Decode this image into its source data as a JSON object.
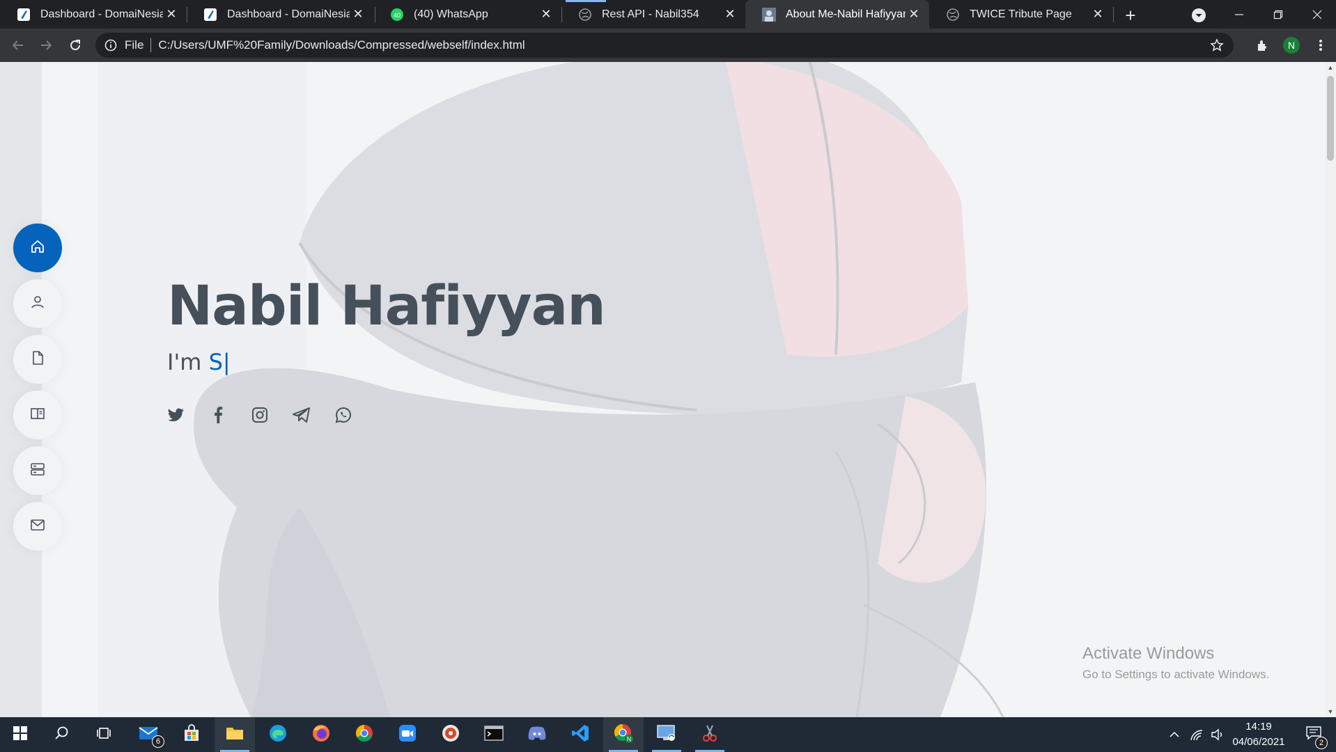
{
  "browser": {
    "tabs": [
      {
        "title": "Dashboard - DomaiNesia",
        "icon": "domainesia-icon",
        "active": false
      },
      {
        "title": "Dashboard - DomaiNesia",
        "icon": "domainesia-icon",
        "active": false
      },
      {
        "title": "(40) WhatsApp",
        "icon": "whatsapp-icon",
        "active": false
      },
      {
        "title": "Rest API - Nabil354",
        "icon": "globe-icon",
        "active": false
      },
      {
        "title": "About Me-Nabil Hafiyyan",
        "icon": "portrait-icon",
        "active": true
      },
      {
        "title": "TWICE Tribute Page",
        "icon": "globe-icon",
        "active": false
      }
    ],
    "close_glyph": "✕",
    "new_tab_glyph": "+",
    "address": {
      "scheme": "File",
      "url": "C:/Users/UMF%20Family/Downloads/Compressed/webself/index.html"
    },
    "profile_initial": "N"
  },
  "page": {
    "name": "Nabil Hafiyyan",
    "subtitle_prefix": "I'm ",
    "subtitle_typed": "S",
    "cursor": "|",
    "accent": "#0563bb",
    "text_color": "#45505b",
    "nav": [
      {
        "icon": "home-icon",
        "active": true
      },
      {
        "icon": "user-icon",
        "active": false
      },
      {
        "icon": "file-icon",
        "active": false
      },
      {
        "icon": "book-icon",
        "active": false
      },
      {
        "icon": "server-icon",
        "active": false
      },
      {
        "icon": "envelope-icon",
        "active": false
      }
    ],
    "socials": [
      "twitter-icon",
      "facebook-icon",
      "instagram-icon",
      "telegram-icon",
      "whatsapp-icon"
    ]
  },
  "watermark": {
    "line1": "Activate Windows",
    "line2": "Go to Settings to activate Windows."
  },
  "taskbar": {
    "mail_badge": "6",
    "time": "14:19",
    "date": "04/06/2021",
    "notification_count": "2"
  }
}
